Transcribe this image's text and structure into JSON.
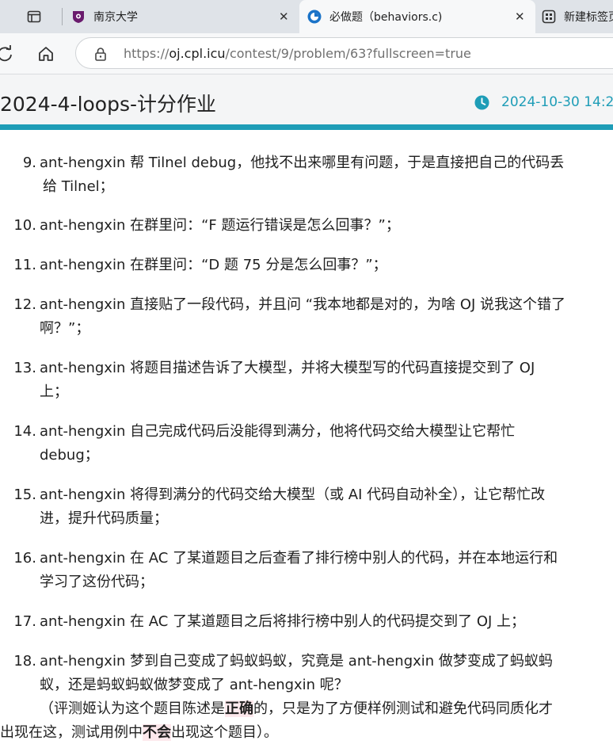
{
  "browser": {
    "tabs": [
      {
        "title": ""
      },
      {
        "title": "南京大学"
      },
      {
        "title": "必做题（behaviors.c)"
      },
      {
        "title": "新建标签页"
      }
    ],
    "url_base": "https://",
    "url_domain": "oj.cpl.icu",
    "url_path": "/contest/9/problem/63?fullscreen=true"
  },
  "header": {
    "contest_title": "2024-4-loops-计分作业",
    "date": "2024-10-30 14:2"
  },
  "items": [
    {
      "num": "9.",
      "lines": [
        "ant-hengxin 帮 Tilnel debug，他找不出来哪里有问题，于是直接把自己的代码丢",
        "给 Tilnel；"
      ]
    },
    {
      "num": "10.",
      "lines": [
        "ant-hengxin 在群里问：“F 题运行错误是怎么回事？”；"
      ]
    },
    {
      "num": "11.",
      "lines": [
        "ant-hengxin 在群里问：“D 题 75 分是怎么回事？”；"
      ]
    },
    {
      "num": "12.",
      "lines": [
        "ant-hengxin 直接贴了一段代码，并且问 “我本地都是对的，为啥 OJ 说我这个错了",
        "啊？”；"
      ]
    },
    {
      "num": "13.",
      "lines": [
        "ant-hengxin 将题目描述告诉了大模型，并将大模型写的代码直接提交到了 OJ",
        "上；"
      ]
    },
    {
      "num": "14.",
      "lines": [
        "ant-hengxin 自己完成代码后没能得到满分，他将代码交给大模型让它帮忙",
        "debug；"
      ]
    },
    {
      "num": "15.",
      "lines": [
        "ant-hengxin 将得到满分的代码交给大模型（或 AI 代码自动补全），让它帮忙改",
        "进，提升代码质量；"
      ]
    },
    {
      "num": "16.",
      "lines": [
        "ant-hengxin 在 AC 了某道题目之后查看了排行榜中别人的代码，并在本地运行和",
        "学习了这份代码；"
      ]
    },
    {
      "num": "17.",
      "lines": [
        "ant-hengxin 在 AC 了某道题目之后将排行榜中别人的代码提交到了 OJ 上；"
      ]
    },
    {
      "num": "18.",
      "lines": [
        "ant-hengxin 梦到自己变成了蚂蚁蚂蚁，究竟是 ant-hengxin 做梦变成了蚂蚁蚂",
        "蚁，还是蚂蚁蚂蚁做梦变成了 ant-hengxin 呢？"
      ],
      "note": {
        "p1": "（评测姬认为这个题目陈述是",
        "h1": "正确",
        "p2": "的，只是为了方便样例测试和避免代码同质化才",
        "p3": "出现在这，测试用例中",
        "h2": "不会",
        "p4": "出现这个题目）。"
      }
    }
  ]
}
